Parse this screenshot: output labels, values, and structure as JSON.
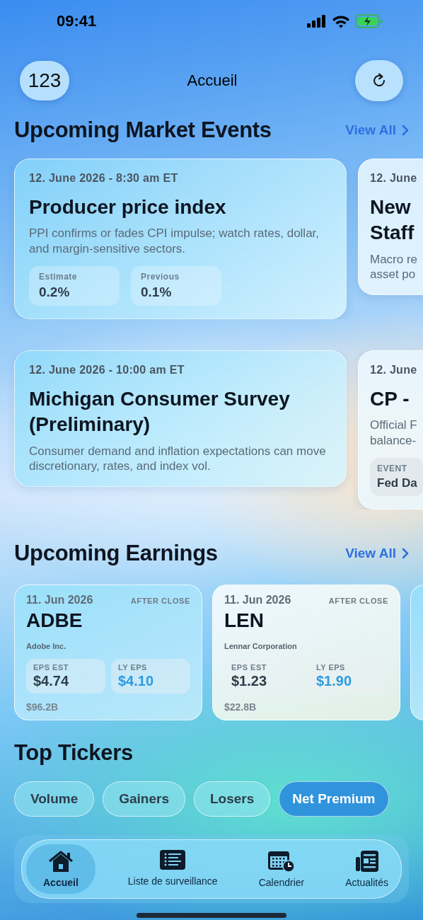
{
  "status_bar": {
    "time": "09:41"
  },
  "header": {
    "badge": "123",
    "title": "Accueil"
  },
  "market_events": {
    "title": "Upcoming Market Events",
    "link": "View All",
    "rows": [
      [
        {
          "kind": "full",
          "date": "12. June 2026 - 8:30 am ET",
          "title": "Producer price index",
          "description": "PPI confirms or fades CPI impulse; watch rates, dollar, and margin-sensitive sectors.",
          "stats": [
            {
              "label": "Estimate",
              "value": "0.2%"
            },
            {
              "label": "Previous",
              "value": "0.1%"
            }
          ]
        },
        {
          "kind": "peek",
          "date": "12. June",
          "title": "New\nStaff",
          "description": "Macro re\nasset po"
        }
      ],
      [
        {
          "kind": "full",
          "date": "12. June 2026 - 10:00 am ET",
          "title": "Michigan Consumer Survey (Preliminary)",
          "description": "Consumer demand and inflation expectations can move discretionary, rates, and index vol."
        },
        {
          "kind": "peek",
          "date": "12. June",
          "title": "CP -",
          "description": "Official F\nbalance-",
          "stats": [
            {
              "label": "EVENT",
              "value": "Fed Da"
            }
          ]
        }
      ]
    ]
  },
  "earnings": {
    "title": "Upcoming Earnings",
    "link": "View All",
    "cards": [
      {
        "kind": "full",
        "date": "11. Jun 2026",
        "timing": "AFTER CLOSE",
        "ticker": "ADBE",
        "company": "Adobe Inc.",
        "stats": [
          {
            "kind": "estimate",
            "label": "EPS EST",
            "value": "$4.74"
          },
          {
            "kind": "prior",
            "label": "LY EPS",
            "value": "$4.10"
          }
        ],
        "market_cap": "$96.2B"
      },
      {
        "kind": "full",
        "date": "11. Jun 2026",
        "timing": "AFTER CLOSE",
        "ticker": "LEN",
        "company": "Lennar Corporation",
        "stats": [
          {
            "kind": "estimate",
            "label": "EPS EST",
            "value": "$1.23"
          },
          {
            "kind": "prior",
            "label": "LY EPS",
            "value": "$1.90"
          }
        ],
        "market_cap": "$22.8B"
      },
      {
        "kind": "peek"
      }
    ]
  },
  "top_tickers": {
    "title": "Top Tickers",
    "filters": [
      {
        "label": "Volume",
        "selected": false
      },
      {
        "label": "Gainers",
        "selected": false
      },
      {
        "label": "Losers",
        "selected": false
      },
      {
        "label": "Net Premium",
        "selected": true
      }
    ]
  },
  "tab_bar": {
    "items": [
      {
        "kind": "home",
        "label": "Accueil",
        "selected": true
      },
      {
        "kind": "list",
        "label": "Liste de surveillance",
        "selected": false
      },
      {
        "kind": "calendar",
        "label": "Calendrier",
        "selected": false
      },
      {
        "kind": "news",
        "label": "Actualités",
        "selected": false
      }
    ]
  }
}
